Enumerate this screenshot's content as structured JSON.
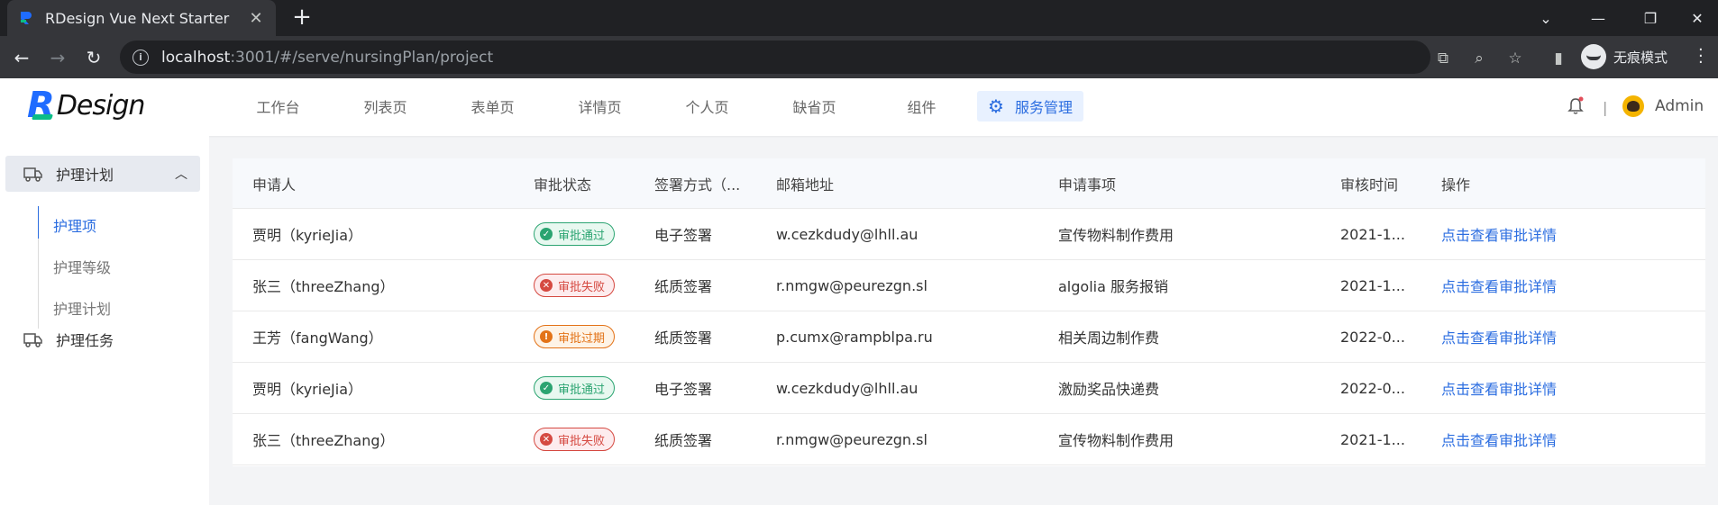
{
  "browser": {
    "tab_title": "RDesign Vue Next Starter",
    "url_host": "localhost",
    "url_rest": ":3001/#/serve/nursingPlan/project",
    "incognito_label": "无痕模式",
    "icons": [
      "back-icon",
      "forward-icon",
      "reload-icon",
      "translate-icon",
      "zoom-icon",
      "star-icon",
      "sidepanel-icon",
      "menu-icon"
    ]
  },
  "header": {
    "logo_r": "R",
    "logo_text": "Design",
    "nav": [
      {
        "label": "工作台"
      },
      {
        "label": "列表页"
      },
      {
        "label": "表单页"
      },
      {
        "label": "详情页"
      },
      {
        "label": "个人页"
      },
      {
        "label": "缺省页"
      },
      {
        "label": "组件"
      },
      {
        "label": "服务管理",
        "active": true
      }
    ],
    "separator": "|",
    "user_name": "Admin",
    "accent_color": "#2b6de0"
  },
  "sidebar": {
    "groups": [
      {
        "label": "护理计划",
        "open": true,
        "children": [
          {
            "label": "护理项",
            "active": true
          },
          {
            "label": "护理等级"
          },
          {
            "label": "护理计划"
          }
        ]
      },
      {
        "label": "护理任务"
      }
    ]
  },
  "table": {
    "columns": [
      "申请人",
      "审批状态",
      "签署方式（...",
      "邮箱地址",
      "申请事项",
      "审核时间",
      "操作"
    ],
    "rows": [
      {
        "applicant": "贾明（kyrieJia）",
        "status": "审批通过",
        "status_kind": "ok",
        "sign": "电子签署",
        "email": "w.cezkdudy@lhll.au",
        "item": "宣传物料制作费用",
        "time": "2021-1...",
        "action": "点击查看审批详情"
      },
      {
        "applicant": "张三（threeZhang）",
        "status": "审批失败",
        "status_kind": "fail",
        "sign": "纸质签署",
        "email": "r.nmgw@peurezgn.sl",
        "item": "algolia 服务报销",
        "time": "2021-1...",
        "action": "点击查看审批详情"
      },
      {
        "applicant": "王芳（fangWang）",
        "status": "审批过期",
        "status_kind": "expired",
        "sign": "纸质签署",
        "email": "p.cumx@rampblpa.ru",
        "item": "相关周边制作费",
        "time": "2022-0...",
        "action": "点击查看审批详情"
      },
      {
        "applicant": "贾明（kyrieJia）",
        "status": "审批通过",
        "status_kind": "ok",
        "sign": "电子签署",
        "email": "w.cezkdudy@lhll.au",
        "item": "激励奖品快递费",
        "time": "2022-0...",
        "action": "点击查看审批详情"
      },
      {
        "applicant": "张三（threeZhang）",
        "status": "审批失败",
        "status_kind": "fail",
        "sign": "纸质签署",
        "email": "r.nmgw@peurezgn.sl",
        "item": "宣传物料制作费用",
        "time": "2021-1...",
        "action": "点击查看审批详情"
      }
    ]
  }
}
